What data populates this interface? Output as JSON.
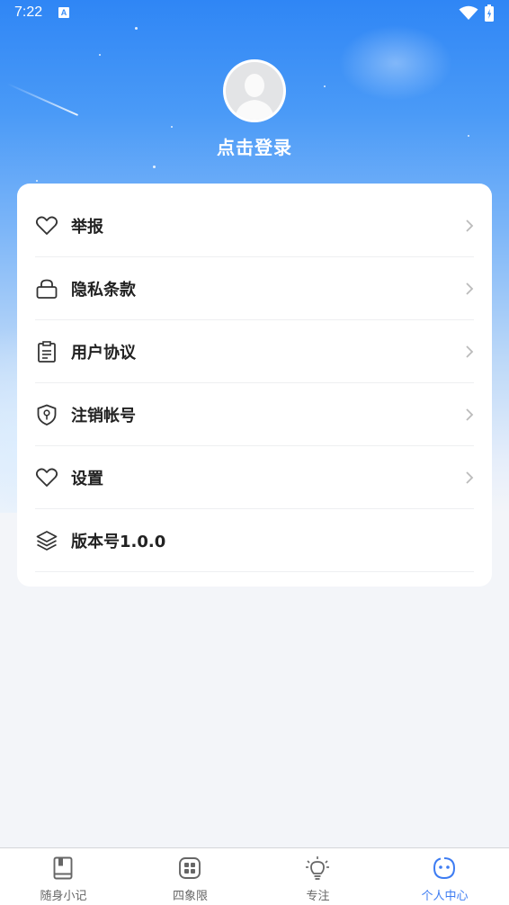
{
  "status_bar": {
    "time": "7:22",
    "notification_icon": "A"
  },
  "profile": {
    "login_label": "点击登录",
    "avatar_icon": "default-avatar"
  },
  "menu": {
    "items": [
      {
        "label": "举报",
        "icon": "heart-icon",
        "has_chevron": true
      },
      {
        "label": "隐私条款",
        "icon": "lock-icon",
        "has_chevron": true
      },
      {
        "label": "用户协议",
        "icon": "clipboard-icon",
        "has_chevron": true
      },
      {
        "label": "注销帐号",
        "icon": "shield-icon",
        "has_chevron": true
      },
      {
        "label": "设置",
        "icon": "heart-icon",
        "has_chevron": true
      },
      {
        "label": "版本号1.0.0",
        "icon": "layers-icon",
        "has_chevron": false
      }
    ]
  },
  "tabs": [
    {
      "label": "随身小记",
      "icon": "notebook-icon",
      "active": false
    },
    {
      "label": "四象限",
      "icon": "grid-icon",
      "active": false
    },
    {
      "label": "专注",
      "icon": "bulb-icon",
      "active": false
    },
    {
      "label": "个人中心",
      "icon": "face-icon",
      "active": true
    }
  ],
  "colors": {
    "accent": "#3d7cf2",
    "hero_top": "#2f86f5",
    "background": "#f3f5f9",
    "text": "#222222",
    "tab_inactive": "#666666"
  }
}
